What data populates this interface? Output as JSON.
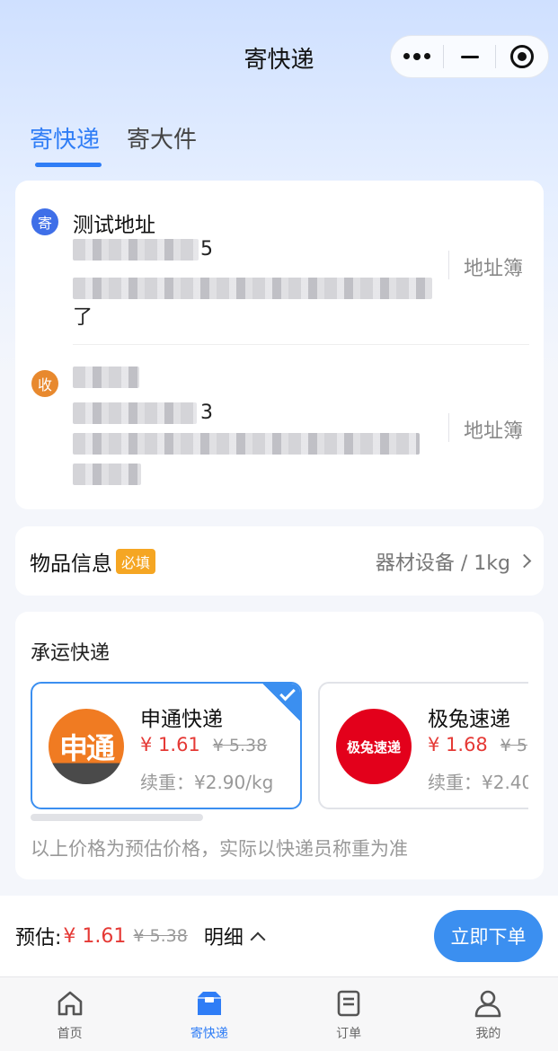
{
  "header": {
    "title": "寄快递"
  },
  "tabs": [
    {
      "label": "寄快递",
      "active": true
    },
    {
      "label": "寄大件",
      "active": false
    }
  ],
  "sender": {
    "badge": "寄",
    "name": "测试地址",
    "phone_tail": "5",
    "address_tail": "了",
    "address_book": "地址簿"
  },
  "receiver": {
    "badge": "收",
    "phone_tail": "3",
    "address_book": "地址簿"
  },
  "goods": {
    "label": "物品信息",
    "required": "必填",
    "value": "器材设备 / 1kg"
  },
  "carriers": {
    "title": "承运快递",
    "items": [
      {
        "name": "申通快递",
        "logo_text": "申通",
        "price": "¥ 1.61",
        "orig": "¥ 5.38",
        "extra": "续重：¥2.90/kg",
        "selected": true
      },
      {
        "name": "极兔速递",
        "logo_text": "极兔速递",
        "price": "¥ 1.68",
        "orig": "¥ 5",
        "extra": "续重：¥2.40",
        "selected": false
      }
    ],
    "note": "以上价格为预估价格，实际以快递员称重为准"
  },
  "footer": {
    "estimate_label": "预估:",
    "estimate_price": "¥ 1.61",
    "estimate_orig": "¥ 5.38",
    "detail_label": "明细",
    "order_button": "立即下单"
  },
  "tabbar": [
    {
      "label": "首页",
      "icon": "home-icon",
      "active": false
    },
    {
      "label": "寄快递",
      "icon": "package-icon",
      "active": true
    },
    {
      "label": "订单",
      "icon": "document-icon",
      "active": false
    },
    {
      "label": "我的",
      "icon": "user-icon",
      "active": false
    }
  ],
  "colors": {
    "accent": "#2f7df6",
    "price": "#e53935",
    "sender_badge": "#3f6fe8",
    "receiver_badge": "#e8892e"
  }
}
